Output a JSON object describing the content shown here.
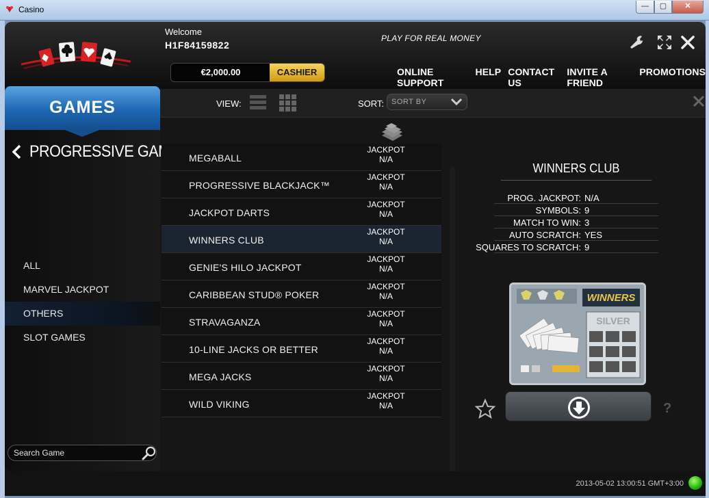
{
  "window": {
    "title": "Casino",
    "min_label": "—",
    "max_label": "▢",
    "close_label": "✕"
  },
  "header": {
    "welcome": "Welcome",
    "username": "H1F84159822",
    "tagline": "PLAY FOR REAL MONEY",
    "balance": "€2,000.00",
    "cashier_label": "CASHIER",
    "nav": [
      "ONLINE SUPPORT",
      "HELP",
      "CONTACT US",
      "INVITE A FRIEND",
      "PROMOTIONS"
    ]
  },
  "sidebar": {
    "tab": "GAMES",
    "section": "PROGRESSIVE GAMES",
    "categories": [
      "ALL",
      "MARVEL JACKPOT",
      "OTHERS",
      "SLOT GAMES"
    ],
    "active_category": "OTHERS",
    "search_placeholder": "Search Game"
  },
  "toolbar": {
    "view_label": "VIEW:",
    "sort_label": "SORT:",
    "sort_value": "SORT BY"
  },
  "games": [
    {
      "name": "MEGABALL",
      "jackpot_label": "JACKPOT",
      "jackpot_value": "N/A"
    },
    {
      "name": "PROGRESSIVE BLACKJACK™",
      "jackpot_label": "JACKPOT",
      "jackpot_value": "N/A"
    },
    {
      "name": "JACKPOT DARTS",
      "jackpot_label": "JACKPOT",
      "jackpot_value": "N/A"
    },
    {
      "name": "WINNERS CLUB",
      "jackpot_label": "JACKPOT",
      "jackpot_value": "N/A"
    },
    {
      "name": "GENIE'S HILO JACKPOT",
      "jackpot_label": "JACKPOT",
      "jackpot_value": "N/A"
    },
    {
      "name": "CARIBBEAN STUD® POKER",
      "jackpot_label": "JACKPOT",
      "jackpot_value": "N/A"
    },
    {
      "name": "STRAVAGANZA",
      "jackpot_label": "JACKPOT",
      "jackpot_value": "N/A"
    },
    {
      "name": "10-LINE JACKS OR BETTER",
      "jackpot_label": "JACKPOT",
      "jackpot_value": "N/A"
    },
    {
      "name": "MEGA JACKS",
      "jackpot_label": "JACKPOT",
      "jackpot_value": "N/A"
    },
    {
      "name": "WILD VIKING",
      "jackpot_label": "JACKPOT",
      "jackpot_value": "N/A"
    }
  ],
  "selected_game": "WINNERS CLUB",
  "details": {
    "title": "WINNERS CLUB",
    "rows": [
      {
        "key": "PROG. JACKPOT:",
        "value": "N/A"
      },
      {
        "key": "SYMBOLS:",
        "value": "9"
      },
      {
        "key": "MATCH TO WIN:",
        "value": "3"
      },
      {
        "key": "AUTO SCRATCH:",
        "value": "YES"
      },
      {
        "key": "SQUARES TO SCRATCH:",
        "value": "9"
      }
    ],
    "thumb_brand": "WINNERS",
    "thumb_sub": "SILVER",
    "help": "?"
  },
  "footer": {
    "timestamp": "2013-05-02 13:00:51 GMT+3:00"
  },
  "colors": {
    "accent_blue": "#1d66b3",
    "cashier_gold": "#e3b531",
    "status_green": "#24b20f",
    "selected_row": "#1b2531"
  }
}
